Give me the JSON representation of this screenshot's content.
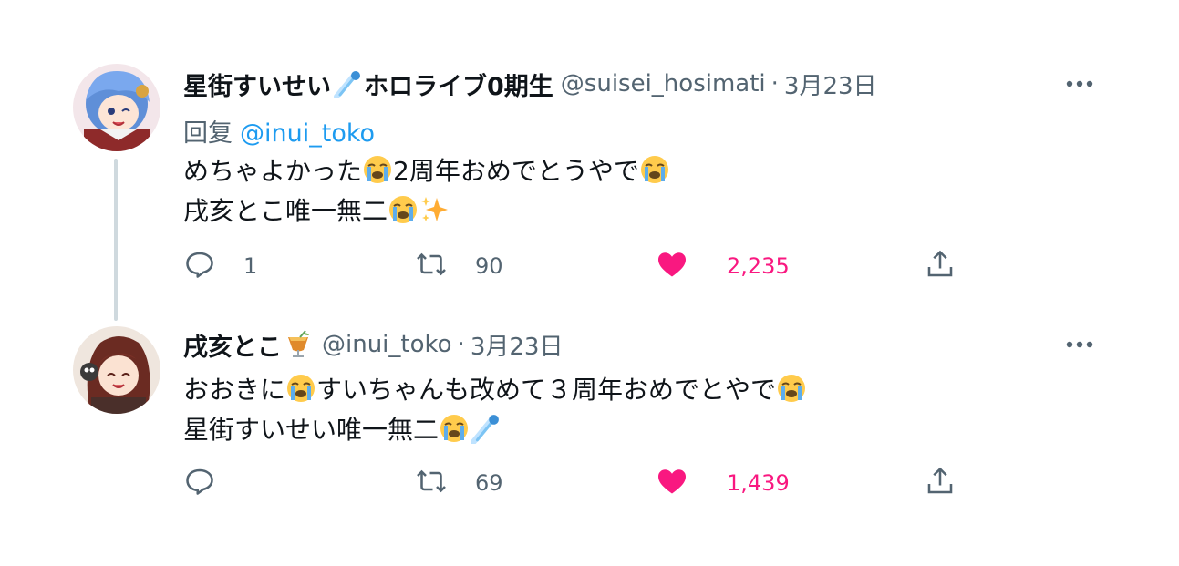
{
  "tweets": [
    {
      "display_name": "星街すいせい",
      "name_suffix": "ホロライブ0期生",
      "handle": "@suisei_hosimati",
      "separator": "·",
      "date": "3月23日",
      "reply_label": "回复",
      "reply_mention": "@inui_toko",
      "body_line1_a": "めちゃよかった",
      "body_line1_b": "2周年おめでとうやで",
      "body_line2_a": "戌亥とこ唯一無二",
      "reply_count": "1",
      "retweet_count": "90",
      "like_count": "2,235"
    },
    {
      "display_name": "戌亥とこ",
      "handle": "@inui_toko",
      "separator": "·",
      "date": "3月23日",
      "body_line1_a": "おおきに",
      "body_line1_b": "すいちゃんも改めて３周年おめでとやで",
      "body_line2_a": "星街すいせい唯一無二",
      "reply_count": "",
      "retweet_count": "69",
      "like_count": "1,439"
    }
  ],
  "colors": {
    "text": "#0f1419",
    "secondary": "#536471",
    "link": "#1d9bf0",
    "like": "#f91880",
    "thread_line": "#cfd9de"
  },
  "icons": [
    "comet-emoji",
    "crying-face-emoji",
    "sparkles-emoji",
    "tropical-drink-emoji",
    "reply-icon",
    "retweet-icon",
    "heart-icon",
    "share-icon",
    "more-icon"
  ]
}
